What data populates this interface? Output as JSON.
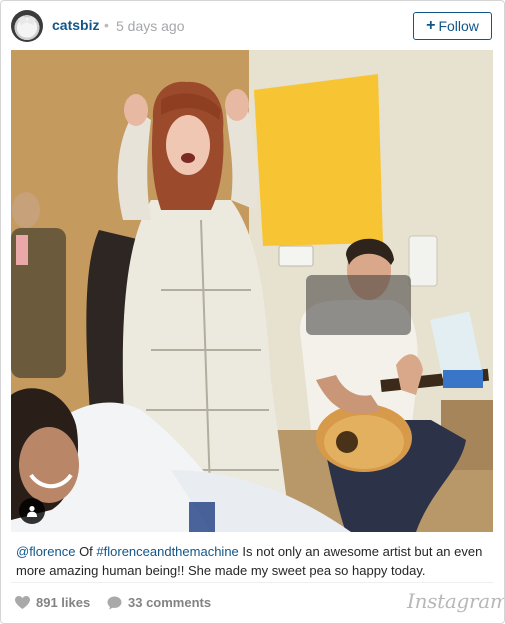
{
  "post": {
    "username": "catsbiz",
    "separator": "•",
    "time_ago": "5 days ago",
    "follow_label": "Follow",
    "follow_icon": "plus-icon",
    "photo_alt_icons": [
      "user-tag-icon"
    ]
  },
  "caption": {
    "mention": "@florence",
    "text_1": " Of ",
    "hashtag": "#florenceandthemachine",
    "text_2": " Is not only an awesome artist but an even more amazing human being!! She made my sweet pea so happy today."
  },
  "stats": {
    "likes": "891 likes",
    "comments": "33 comments",
    "like_icon": "heart-icon",
    "comment_icon": "comment-bubble-icon"
  },
  "branding": {
    "logo_text": "Instagram"
  },
  "colors": {
    "link": "#125688",
    "meta": "#a5a7aa",
    "stat": "#838383"
  }
}
